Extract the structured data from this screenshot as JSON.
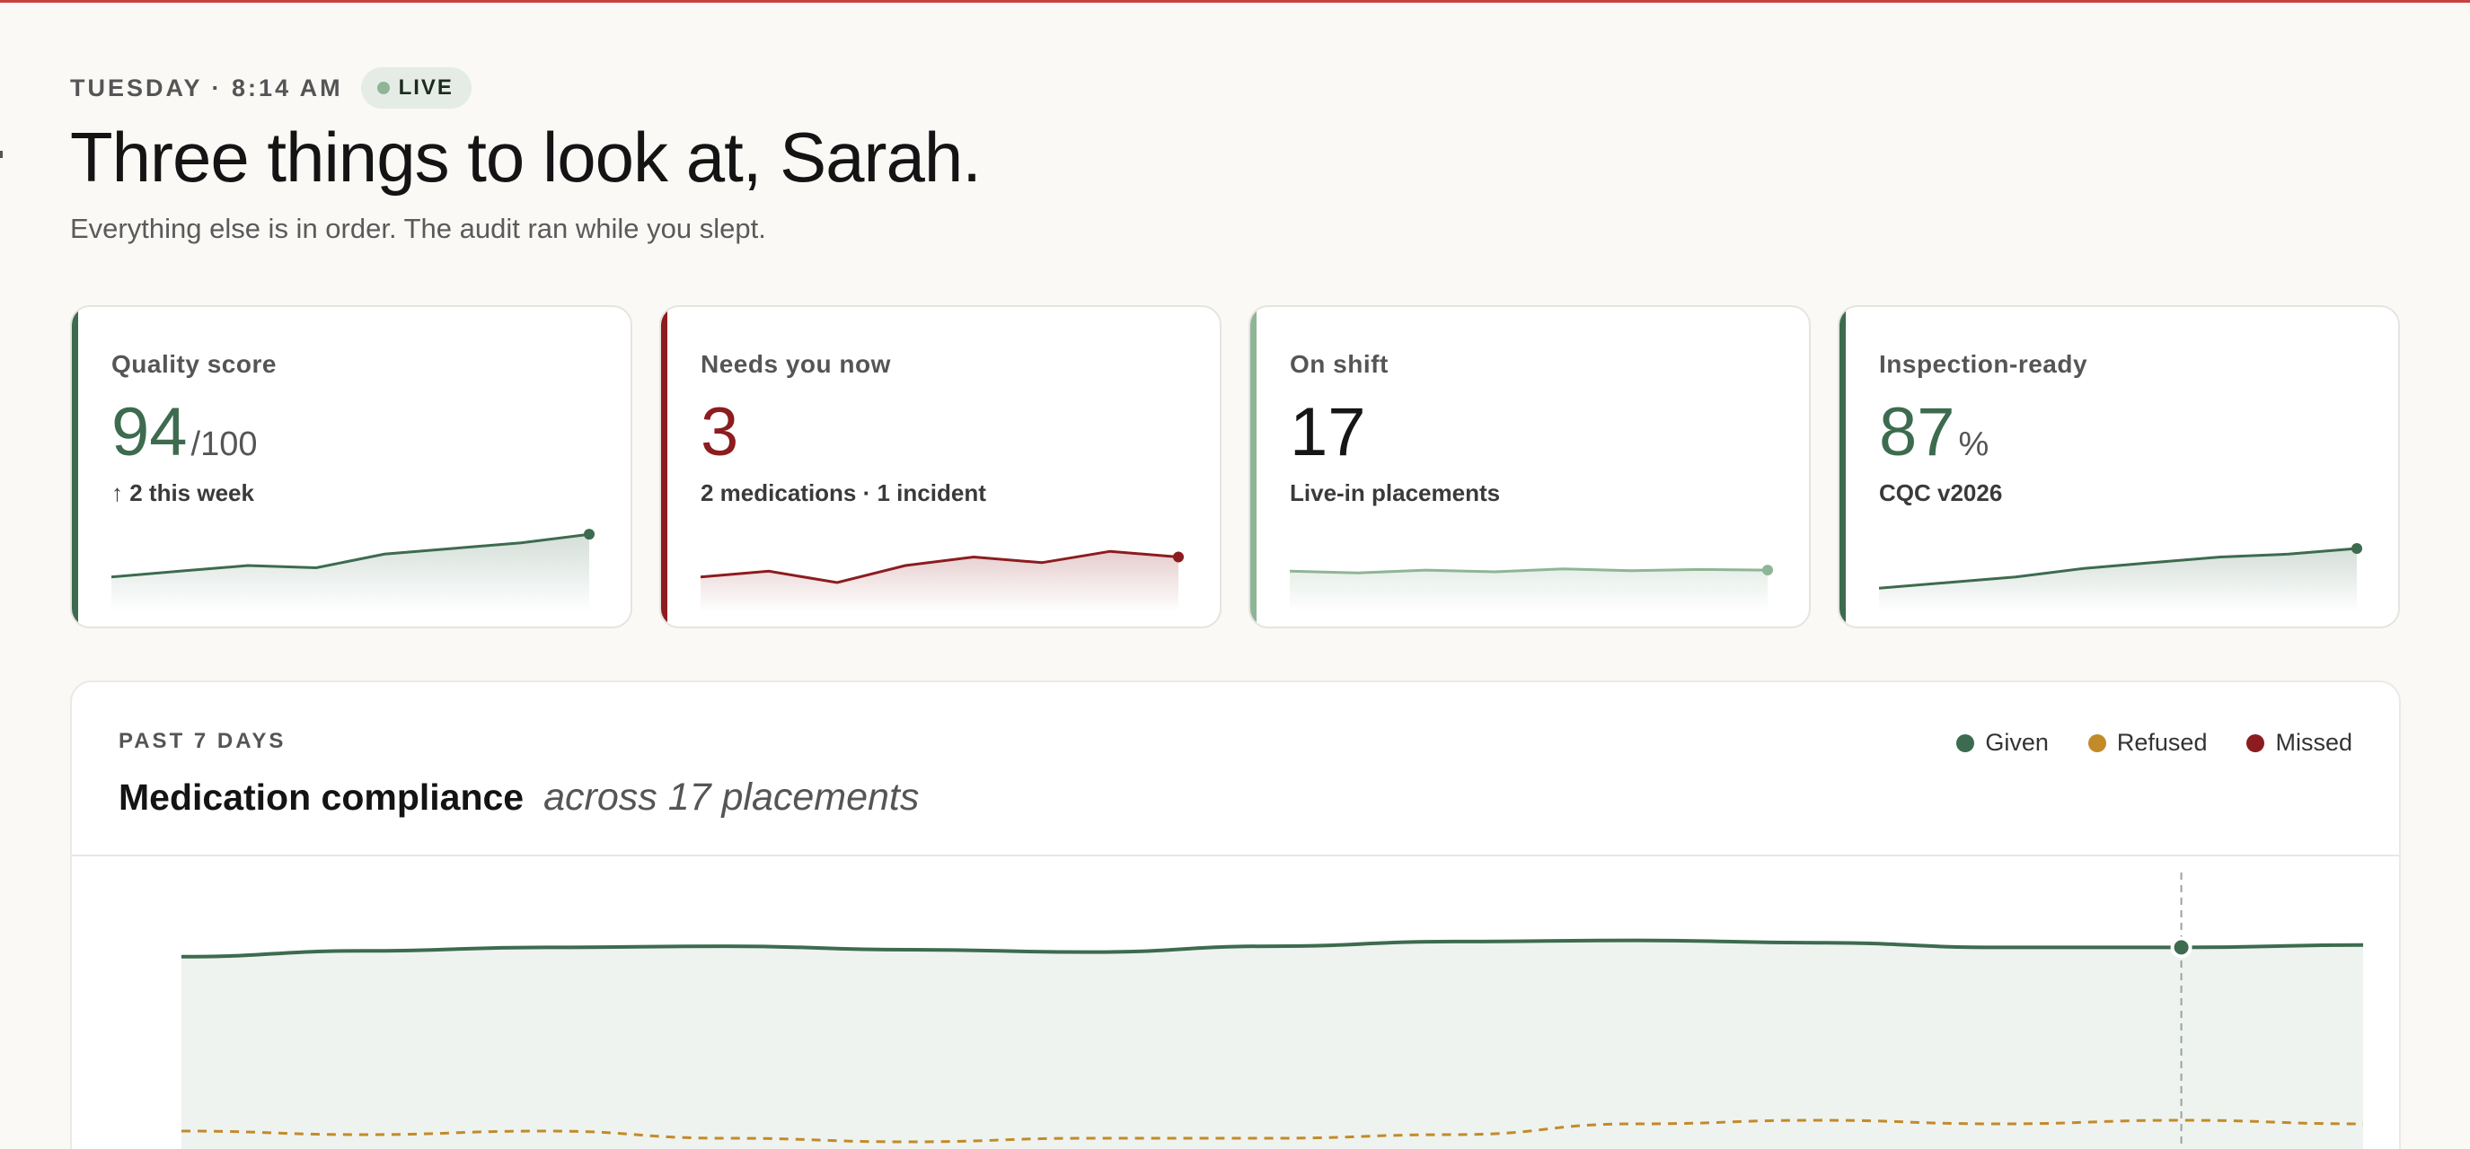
{
  "header": {
    "eyebrow": "TUESDAY · 8:14 AM",
    "live_label": "LIVE",
    "headline": "Three things to look at, Sarah.",
    "subhead": "Everything else is in order. The audit ran while you slept."
  },
  "kpis": [
    {
      "label": "Quality score",
      "value": "94",
      "suffix": "/100",
      "note": "↑ 2 this week",
      "color": "#3d6b4f",
      "trend": [
        4,
        5,
        6,
        5.6,
        8,
        9,
        10,
        11.5
      ]
    },
    {
      "label": "Needs you now",
      "value": "3",
      "suffix": "",
      "note": "2 medications · 1 incident",
      "color": "#8c1c1f",
      "trend": [
        4,
        5,
        3,
        6,
        7.5,
        6.5,
        8.5,
        7.5
      ]
    },
    {
      "label": "On shift",
      "value": "17",
      "suffix": "",
      "note": "Live-in placements",
      "color": "#8fb597",
      "trend": [
        5,
        4.7,
        5.2,
        4.9,
        5.4,
        5.1,
        5.3,
        5.2
      ]
    },
    {
      "label": "Inspection-ready",
      "value": "87",
      "suffix": "%",
      "note": "CQC v2026",
      "color": "#3d6b4f",
      "trend": [
        2,
        3,
        4,
        5.5,
        6.5,
        7.5,
        8,
        9
      ]
    }
  ],
  "compliance": {
    "eyebrow": "PAST 7 DAYS",
    "title": "Medication compliance",
    "subtitle": "across 17 placements",
    "legend": [
      {
        "label": "Given",
        "color": "#3d6b4f"
      },
      {
        "label": "Refused",
        "color": "#c38a2a"
      },
      {
        "label": "Missed",
        "color": "#8c1c1f"
      }
    ]
  },
  "chart_data": {
    "type": "area",
    "title": "Medication compliance",
    "subtitle": "across 17 placements",
    "x": [
      0,
      1,
      2,
      3,
      4,
      5,
      6,
      7,
      8,
      9,
      10,
      11,
      12
    ],
    "series": [
      {
        "name": "Given",
        "color": "#3d6b4f",
        "style": "solid",
        "fill": true,
        "values": [
          97.4,
          97.9,
          98.2,
          98.3,
          98.0,
          97.8,
          98.3,
          98.7,
          98.8,
          98.6,
          98.2,
          98.2,
          98.4
        ]
      },
      {
        "name": "Refused",
        "color": "#c38a2a",
        "style": "dashed",
        "fill": false,
        "values": [
          0.8,
          0.7,
          0.8,
          0.6,
          0.5,
          0.6,
          0.6,
          0.7,
          1.0,
          1.1,
          1.0,
          1.1,
          1.0
        ]
      }
    ],
    "ylim": [
      0,
      100
    ],
    "highlight_index": 11,
    "grid": true
  }
}
